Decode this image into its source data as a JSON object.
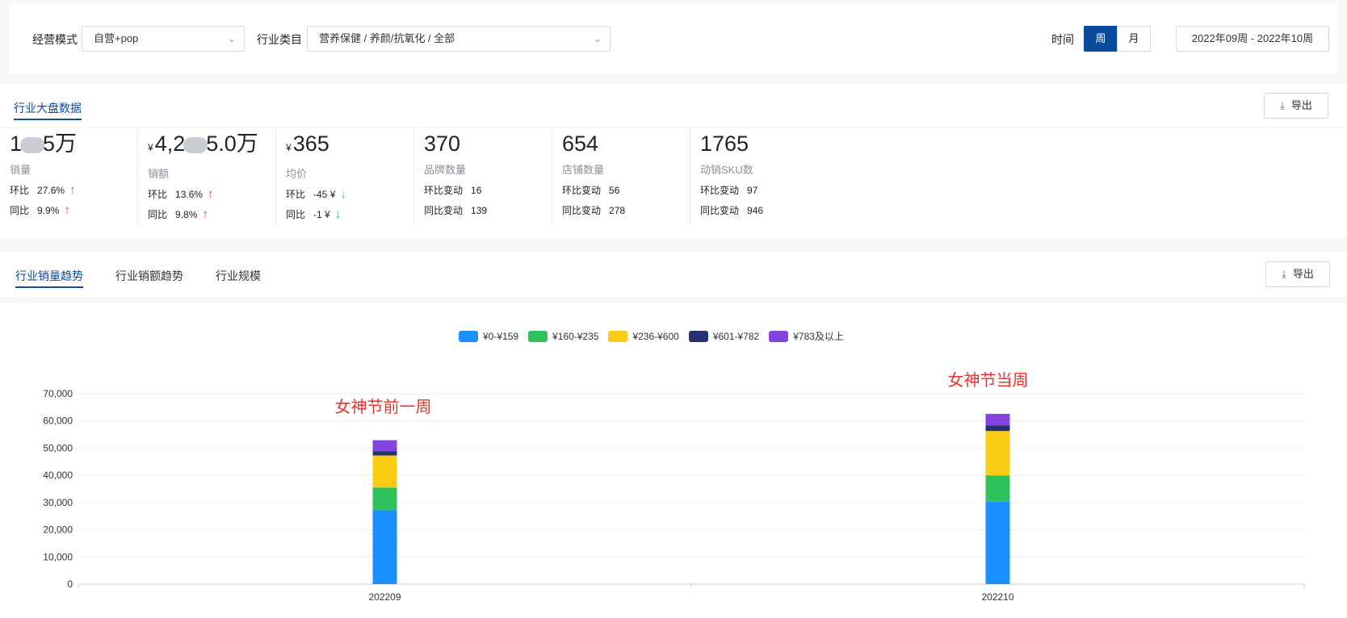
{
  "filters": {
    "mode_label": "经营模式",
    "mode_value": "自营+pop",
    "category_label": "行业类目",
    "category_value": "营养保健 / 养颜/抗氧化 / 全部",
    "time_label": "时间",
    "week_label": "周",
    "month_label": "月",
    "date_range": "2022年09周 - 2022年10周",
    "active_period": "week"
  },
  "overview": {
    "tab_label": "行业大盘数据",
    "export_label": "导出",
    "metrics": [
      {
        "value_prefix": "1",
        "value_suffix": "5万",
        "blurred": true,
        "name": "销量",
        "r1_key": "环比",
        "r1_val": "27.6%",
        "r1_dir": "up",
        "r2_key": "同比",
        "r2_val": "9.9%",
        "r2_dir": "up"
      },
      {
        "yen": "¥",
        "value_prefix": "4,2",
        "value_suffix": "5.0万",
        "blurred": true,
        "name": "销额",
        "r1_key": "环比",
        "r1_val": "13.6%",
        "r1_dir": "up",
        "r2_key": "同比",
        "r2_val": "9.8%",
        "r2_dir": "up"
      },
      {
        "yen": "¥",
        "value": "365",
        "name": "均价",
        "r1_key": "环比",
        "r1_val": "-45 ¥",
        "r1_dir": "down",
        "r2_key": "同比",
        "r2_val": "-1 ¥",
        "r2_dir": "down"
      },
      {
        "value": "370",
        "name": "品牌数量",
        "r1_key": "环比变动",
        "r1_val": "16",
        "r2_key": "同比变动",
        "r2_val": "139"
      },
      {
        "value": "654",
        "name": "店铺数量",
        "r1_key": "环比变动",
        "r1_val": "56",
        "r2_key": "同比变动",
        "r2_val": "278"
      },
      {
        "value": "1765",
        "name": "动销SKU数",
        "r1_key": "环比变动",
        "r1_val": "97",
        "r2_key": "同比变动",
        "r2_val": "946"
      }
    ]
  },
  "trend": {
    "tabs": [
      "行业销量趋势",
      "行业销额趋势",
      "行业规模"
    ],
    "active_tab": 0,
    "export_label": "导出"
  },
  "colors": {
    "accent": "#0a4b9e",
    "up": "#f5414c",
    "down": "#36c06a",
    "annotation": "#f0302a"
  },
  "icons": {
    "chevron": "chevron-down-icon",
    "export": "download-icon",
    "up": "arrow-up-icon",
    "down": "arrow-down-icon"
  },
  "chart_data": {
    "type": "bar",
    "stacked": true,
    "categories": [
      "202209",
      "202210"
    ],
    "series": [
      {
        "name": "¥0-¥159",
        "color": "#1890ff",
        "values": [
          27200,
          30300
        ]
      },
      {
        "name": "¥160-¥235",
        "color": "#2fc25b",
        "values": [
          8300,
          9700
        ]
      },
      {
        "name": "¥236-¥600",
        "color": "#facc14",
        "values": [
          11800,
          16300
        ]
      },
      {
        "name": "¥601-¥782",
        "color": "#223273",
        "values": [
          1600,
          2000
        ]
      },
      {
        "name": "¥783及以上",
        "color": "#8543e0",
        "values": [
          4000,
          4300
        ]
      }
    ],
    "ylim": [
      0,
      70000
    ],
    "yticks": [
      "0",
      "10,000",
      "20,000",
      "30,000",
      "40,000",
      "50,000",
      "60,000",
      "70,000"
    ],
    "grid": true,
    "legend_position": "top-center",
    "annotations": [
      {
        "category": "202209",
        "text": "女神节前一周"
      },
      {
        "category": "202210",
        "text": "女神节当周"
      }
    ]
  }
}
